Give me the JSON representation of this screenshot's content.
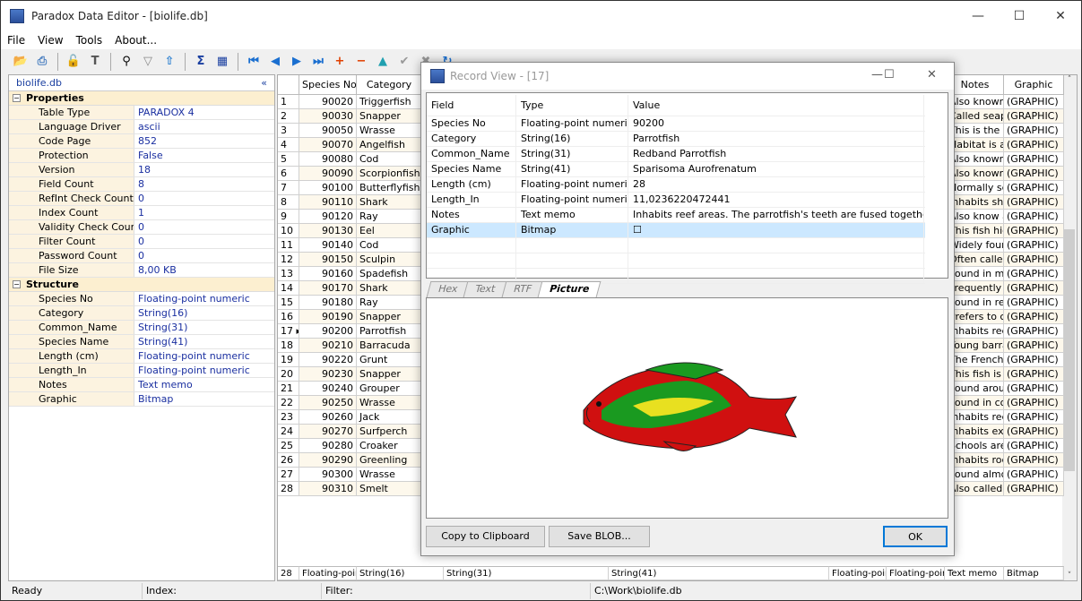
{
  "app": {
    "title": "Paradox Data Editor - [biolife.db]"
  },
  "menu": [
    "File",
    "View",
    "Tools",
    "About..."
  ],
  "colors": {
    "accent": "#1a3fa0",
    "selection": "#cce8ff",
    "property_bg": "#fcf3e0"
  },
  "left": {
    "title": "biolife.db",
    "collapse": "«",
    "properties_label": "Properties",
    "structure_label": "Structure",
    "properties": [
      [
        "Table Type",
        "PARADOX 4"
      ],
      [
        "Language Driver",
        "ascii"
      ],
      [
        "Code Page",
        "852"
      ],
      [
        "Protection",
        "False"
      ],
      [
        "Version",
        "18"
      ],
      [
        "Field Count",
        "8"
      ],
      [
        "RefInt Check Count",
        "0"
      ],
      [
        "Index Count",
        "1"
      ],
      [
        "Validity Check Count",
        "0"
      ],
      [
        "Filter Count",
        "0"
      ],
      [
        "Password Count",
        "0"
      ],
      [
        "File Size",
        "8,00 KB"
      ]
    ],
    "structure": [
      [
        "Species No",
        "Floating-point numeric"
      ],
      [
        "Category",
        "String(16)"
      ],
      [
        "Common_Name",
        "String(31)"
      ],
      [
        "Species Name",
        "String(41)"
      ],
      [
        "Length (cm)",
        "Floating-point numeric"
      ],
      [
        "Length_In",
        "Floating-point numeric"
      ],
      [
        "Notes",
        "Text memo"
      ],
      [
        "Graphic",
        "Bitmap"
      ]
    ]
  },
  "grid": {
    "headers": {
      "species": "Species No",
      "category": "Category",
      "notes": "Notes",
      "graphic": "Graphic"
    },
    "rows": [
      [
        "1",
        "90020",
        "Triggerfish",
        "Also known a"
      ],
      [
        "2",
        "90030",
        "Snapper",
        "Called seape"
      ],
      [
        "3",
        "90050",
        "Wrasse",
        "This is the lar"
      ],
      [
        "4",
        "90070",
        "Angelfish",
        "Habitat is arc"
      ],
      [
        "5",
        "90080",
        "Cod",
        "Also known a"
      ],
      [
        "6",
        "90090",
        "Scorpionfish",
        "Also known a"
      ],
      [
        "7",
        "90100",
        "Butterflyfish",
        "Normally see"
      ],
      [
        "8",
        "90110",
        "Shark",
        "Inhabits shal"
      ],
      [
        "9",
        "90120",
        "Ray",
        "Also know as"
      ],
      [
        "10",
        "90130",
        "Eel",
        "This fish hide"
      ],
      [
        "11",
        "90140",
        "Cod",
        "Widely found"
      ],
      [
        "12",
        "90150",
        "Sculpin",
        "Often called"
      ],
      [
        "13",
        "90160",
        "Spadefish",
        "Found in mid"
      ],
      [
        "14",
        "90170",
        "Shark",
        "Frequently fo"
      ],
      [
        "15",
        "90180",
        "Ray",
        "Found in reef"
      ],
      [
        "16",
        "90190",
        "Snapper",
        "Prefers to co"
      ],
      [
        "17",
        "90200",
        "Parrotfish",
        "Inhabits reef"
      ],
      [
        "18",
        "90210",
        "Barracuda",
        "Young barrac"
      ],
      [
        "19",
        "90220",
        "Grunt",
        "The French g"
      ],
      [
        "20",
        "90230",
        "Snapper",
        "This fish is na"
      ],
      [
        "21",
        "90240",
        "Grouper",
        "Found aroun"
      ],
      [
        "22",
        "90250",
        "Wrasse",
        "Found in cora"
      ],
      [
        "23",
        "90260",
        "Jack",
        "Inhabits reef"
      ],
      [
        "24",
        "90270",
        "Surfperch",
        "Inhabits expo"
      ],
      [
        "25",
        "90280",
        "Croaker",
        "Schools are f"
      ],
      [
        "26",
        "90290",
        "Greenling",
        "Inhabits rock"
      ],
      [
        "27",
        "90300",
        "Wrasse",
        "Found almost"
      ],
      [
        "28",
        "90310",
        "Smelt",
        "Also called th"
      ]
    ],
    "graphic_value": "(GRAPHIC)",
    "footer": [
      "28",
      "Floating-poir",
      "String(16)",
      "String(31)",
      "String(41)",
      "Floating-poir",
      "Floating-poir",
      "Text memo",
      "Bitmap"
    ]
  },
  "status": {
    "ready": "Ready",
    "index": "Index:",
    "filter": "Filter:",
    "path": "C:\\Work\\biolife.db"
  },
  "dialog": {
    "title": "Record View - [17]",
    "headers": [
      "Field",
      "Type",
      "Value"
    ],
    "rows": [
      [
        "Species No",
        "Floating-point numeric",
        "90200"
      ],
      [
        "Category",
        "String(16)",
        "Parrotfish"
      ],
      [
        "Common_Name",
        "String(31)",
        "Redband Parrotfish"
      ],
      [
        "Species Name",
        "String(41)",
        "Sparisoma Aurofrenatum"
      ],
      [
        "Length (cm)",
        "Floating-point numeric",
        "28"
      ],
      [
        "Length_In",
        "Floating-point numeric",
        "11,0236220472441"
      ],
      [
        "Notes",
        "Text memo",
        "Inhabits reef areas.  The parrotfish's teeth are fused together,..."
      ],
      [
        "Graphic",
        "Bitmap",
        "☐"
      ]
    ],
    "tabs": [
      "Hex",
      "Text",
      "RTF",
      "Picture"
    ],
    "active_tab": "Picture",
    "copy": "Copy to Clipboard",
    "save": "Save BLOB...",
    "ok": "OK"
  }
}
